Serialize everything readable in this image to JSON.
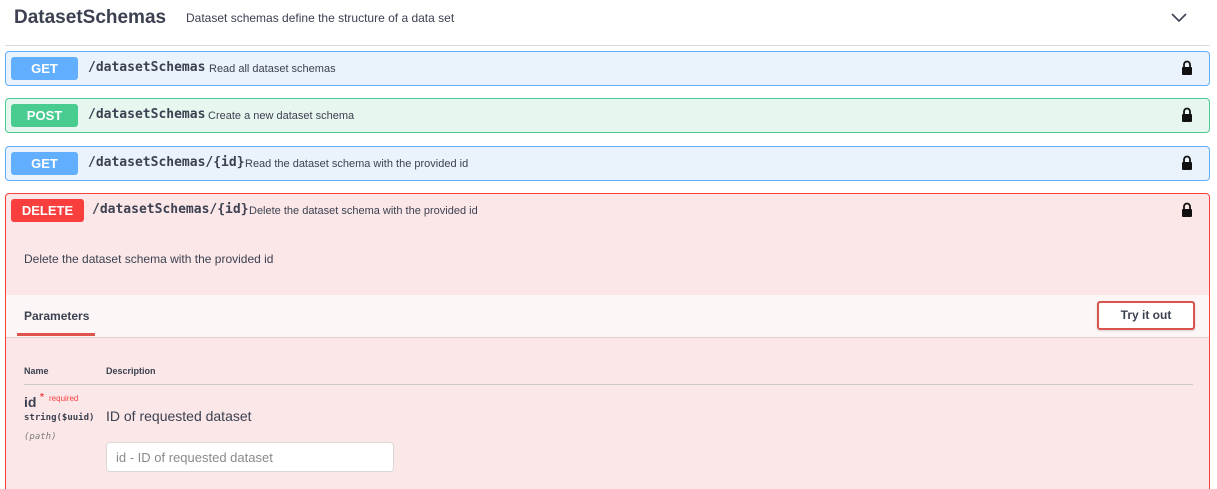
{
  "tag": {
    "title": "DatasetSchemas",
    "description": "Dataset schemas define the structure of a data set",
    "chevron_icon": "chevron-down-icon"
  },
  "operations": [
    {
      "method": "GET",
      "path": "/datasetSchemas",
      "summary": "Read all dataset schemas",
      "color": "#61affe"
    },
    {
      "method": "POST",
      "path": "/datasetSchemas",
      "summary": "Create a new dataset schema",
      "color": "#49cc90"
    },
    {
      "method": "GET",
      "path": "/datasetSchemas/{id}",
      "summary": "Read the dataset schema with the provided id",
      "color": "#61affe"
    },
    {
      "method": "DELETE",
      "path": "/datasetSchemas/{id}",
      "summary": "Delete the dataset schema with the provided id",
      "color": "#f93e3e"
    }
  ],
  "lock_icon": "lock-icon",
  "expanded": {
    "description": "Delete the dataset schema with the provided id",
    "params_tab": "Parameters",
    "try_button": "Try it out",
    "columns": {
      "name": "Name",
      "description": "Description"
    },
    "param": {
      "name": "id",
      "required_star": "*",
      "required_label": "required",
      "type": "string($uuid)",
      "in": "(path)",
      "description": "ID of requested dataset",
      "placeholder": "id - ID of requested dataset"
    }
  }
}
